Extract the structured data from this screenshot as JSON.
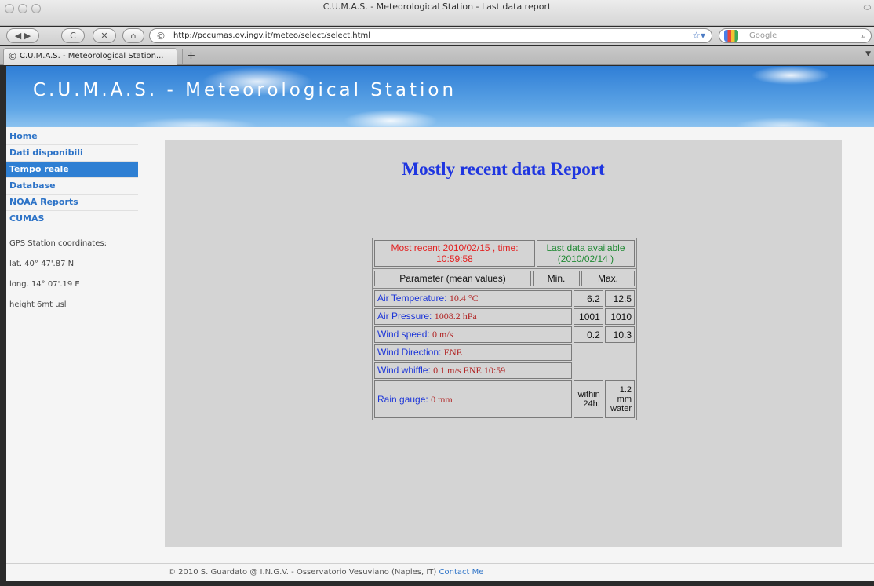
{
  "window": {
    "title": "C.U.M.A.S. - Meteorological Station - Last data report"
  },
  "toolbar": {
    "url": "http://pccumas.ov.ingv.it/meteo/select/select.html",
    "search_placeholder": "Google",
    "back_glyph": "◀",
    "forward_glyph": "▶",
    "reload_glyph": "C",
    "stop_glyph": "✕",
    "home_glyph": "⌂"
  },
  "tabs": [
    {
      "label": "C.U.M.A.S. - Meteorological Station..."
    }
  ],
  "newtab_label": "+",
  "banner": {
    "title": "C.U.M.A.S. - Meteorological Station"
  },
  "sidebar": {
    "items": [
      {
        "label": "Home"
      },
      {
        "label": "Dati disponibili"
      },
      {
        "label": "Tempo reale"
      },
      {
        "label": "Database"
      },
      {
        "label": "NOAA Reports"
      },
      {
        "label": "CUMAS"
      }
    ],
    "active_index": 2,
    "gps": {
      "heading": "GPS Station coordinates:",
      "lat": "lat. 40° 47'.87 N",
      "long": "long. 14° 07'.19 E",
      "height": "height 6mt usl"
    }
  },
  "report": {
    "title": "Mostly recent data Report",
    "most_recent": "Most recent  2010/02/15 , time: 10:59:58",
    "last_available": "Last data available (2010/02/14 )",
    "col_param": "Parameter (mean values)",
    "col_min": "Min.",
    "col_max": "Max.",
    "rows": [
      {
        "label": "Air Temperature:",
        "value": "10.4 °C",
        "min": "6.2",
        "max": "12.5"
      },
      {
        "label": "Air Pressure:",
        "value": "1008.2 hPa",
        "min": "1001",
        "max": "1010"
      },
      {
        "label": "Wind speed:",
        "value": "0 m/s",
        "min": "0.2",
        "max": "10.3"
      },
      {
        "label": "Wind Direction:",
        "value": "ENE"
      },
      {
        "label": "Wind whiffle:",
        "value": "0.1 m/s ENE  10:59"
      }
    ],
    "rain": {
      "label": "Rain gauge:",
      "value": "0 mm",
      "within": "within 24h:",
      "amount": "1.2 mm water"
    }
  },
  "footer": {
    "text": "© 2010 S. Guardato @ I.N.G.V. - Osservatorio Vesuviano (Naples, IT) ",
    "contact": "Contact Me"
  },
  "colors": {
    "accent": "#2e7fd3",
    "title_blue": "#1f36e0",
    "recent_red": "#e32020",
    "last_green": "#218a35",
    "value_red": "#b12525"
  }
}
